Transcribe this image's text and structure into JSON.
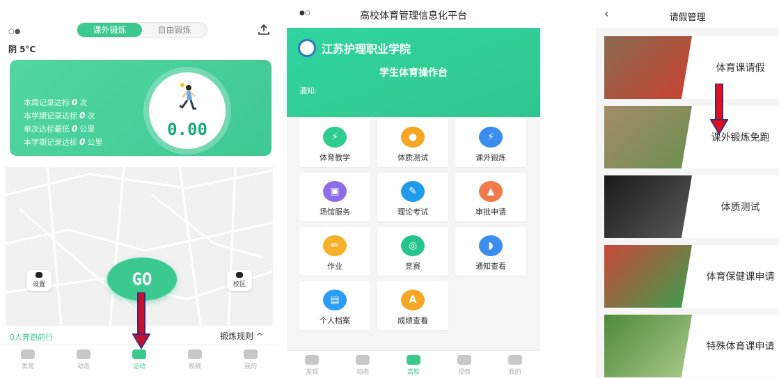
{
  "panel1": {
    "status_dots": "○●",
    "mode_tabs": [
      "课外锻炼",
      "自由锻炼"
    ],
    "weather": "阴 5°C",
    "stats": [
      {
        "prefix": "本周记录达标",
        "value": "0",
        "unit": "次"
      },
      {
        "prefix": "本学期记录达标",
        "value": "0",
        "unit": "次"
      },
      {
        "prefix": "单次达标最低",
        "value": "0",
        "unit": "公里"
      },
      {
        "prefix": "本学期记录达标",
        "value": "0",
        "unit": "公里"
      }
    ],
    "distance": "0.00",
    "map_buttons": {
      "settings": "设置",
      "campus": "校区"
    },
    "go_label": "GO",
    "run_count": "0人奔跑前行",
    "rules_link": "锻炼规则",
    "tabbar": [
      "发现",
      "动态",
      "运动",
      "视频",
      "我的"
    ],
    "active_tab": 2,
    "colors": {
      "accent": "#3cc98f",
      "arrow": "#c8102e"
    }
  },
  "panel2": {
    "status_dots": "●○",
    "title": "高校体育管理信息化平台",
    "school": "江苏护理职业学院",
    "platform": "学生体育操作台",
    "notice": "通知:",
    "menu": [
      {
        "label": "体育教学",
        "icon": "run-icon",
        "color": "#2ecc8f"
      },
      {
        "label": "体质测试",
        "icon": "person-icon",
        "color": "#f5a623"
      },
      {
        "label": "课外锻炼",
        "icon": "run-icon",
        "color": "#3b8ef0"
      },
      {
        "label": "场馆服务",
        "icon": "building-icon",
        "color": "#8e6be8"
      },
      {
        "label": "理论考试",
        "icon": "pen-icon",
        "color": "#1e9be9"
      },
      {
        "label": "审批申请",
        "icon": "stamp-icon",
        "color": "#f07a4a"
      },
      {
        "label": "作业",
        "icon": "pencil-icon",
        "color": "#f5b12a"
      },
      {
        "label": "竞赛",
        "icon": "medal-icon",
        "color": "#25c48a"
      },
      {
        "label": "通知查看",
        "icon": "bell-icon",
        "color": "#3b8ef0"
      },
      {
        "label": "个人档案",
        "icon": "id-card-icon",
        "color": "#2a9df4"
      },
      {
        "label": "成绩查看",
        "icon": "grade-icon",
        "color": "#f5a623"
      }
    ],
    "tabbar": [
      "发现",
      "动态",
      "高校",
      "视频",
      "我的"
    ],
    "active_tab": 2
  },
  "panel3": {
    "back": "‹",
    "title": "请假管理",
    "rows": [
      {
        "label": "体育课请假",
        "thumb": "basketball-photo",
        "colors": [
          "#8a6b50",
          "#c9402f"
        ]
      },
      {
        "label": "课外锻炼免跑",
        "thumb": "runner-photo",
        "colors": [
          "#a58b6a",
          "#6b8f4e"
        ]
      },
      {
        "label": "体质测试",
        "thumb": "dumbbell-photo",
        "colors": [
          "#1a1a1a",
          "#5a5a5a"
        ]
      },
      {
        "label": "体育保健课申请",
        "thumb": "track-photo",
        "colors": [
          "#c9483a",
          "#3aa04e"
        ]
      },
      {
        "label": "特殊体育课申请",
        "thumb": "park-photo",
        "colors": [
          "#4e8a3a",
          "#a9c98a"
        ]
      }
    ]
  }
}
